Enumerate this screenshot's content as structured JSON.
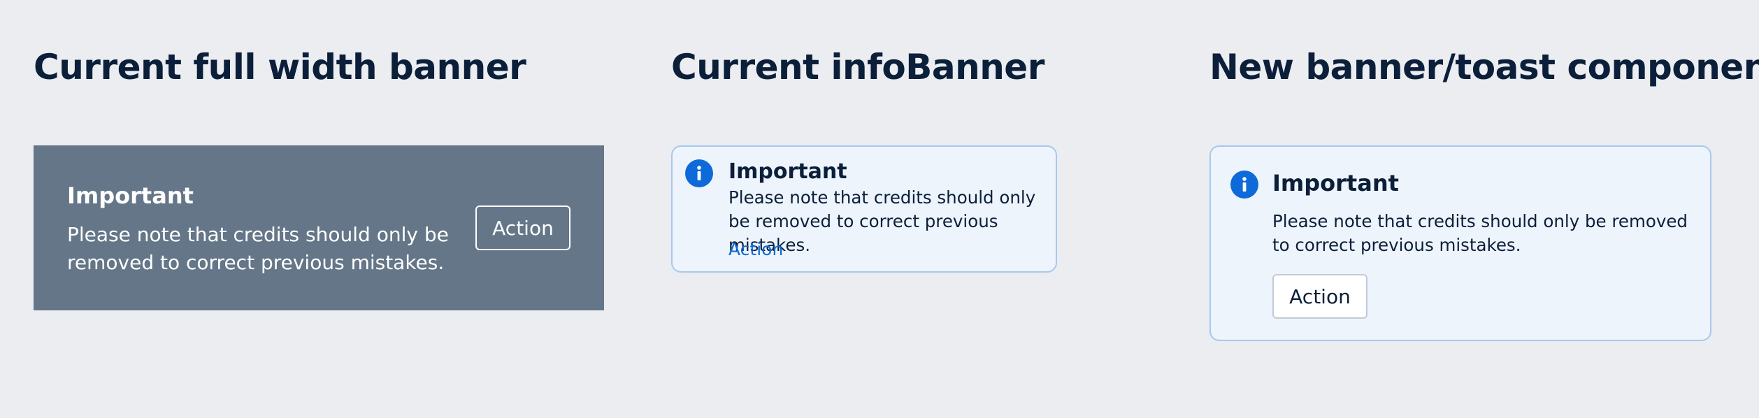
{
  "sections": {
    "full_width": {
      "title": "Current full width banner"
    },
    "info_banner": {
      "title": "Current infoBanner"
    },
    "new_toast": {
      "title": "New banner/toast component"
    }
  },
  "full_width_banner": {
    "heading": "Important",
    "body": "Please note that credits should only be removed to correct previous mistakes.",
    "action_label": "Action",
    "background_color": "#647688"
  },
  "info_banner": {
    "icon": "info-icon",
    "heading": "Important",
    "body": "Please note that credits should only be removed to correct previous mistakes.",
    "action_label": "Action",
    "accent_color": "#0d6ad8"
  },
  "toast": {
    "icon": "info-icon",
    "heading": "Important",
    "body": "Please note that credits should only be removed to correct previous mistakes.",
    "action_label": "Action",
    "accent_color": "#0d6ad8"
  }
}
